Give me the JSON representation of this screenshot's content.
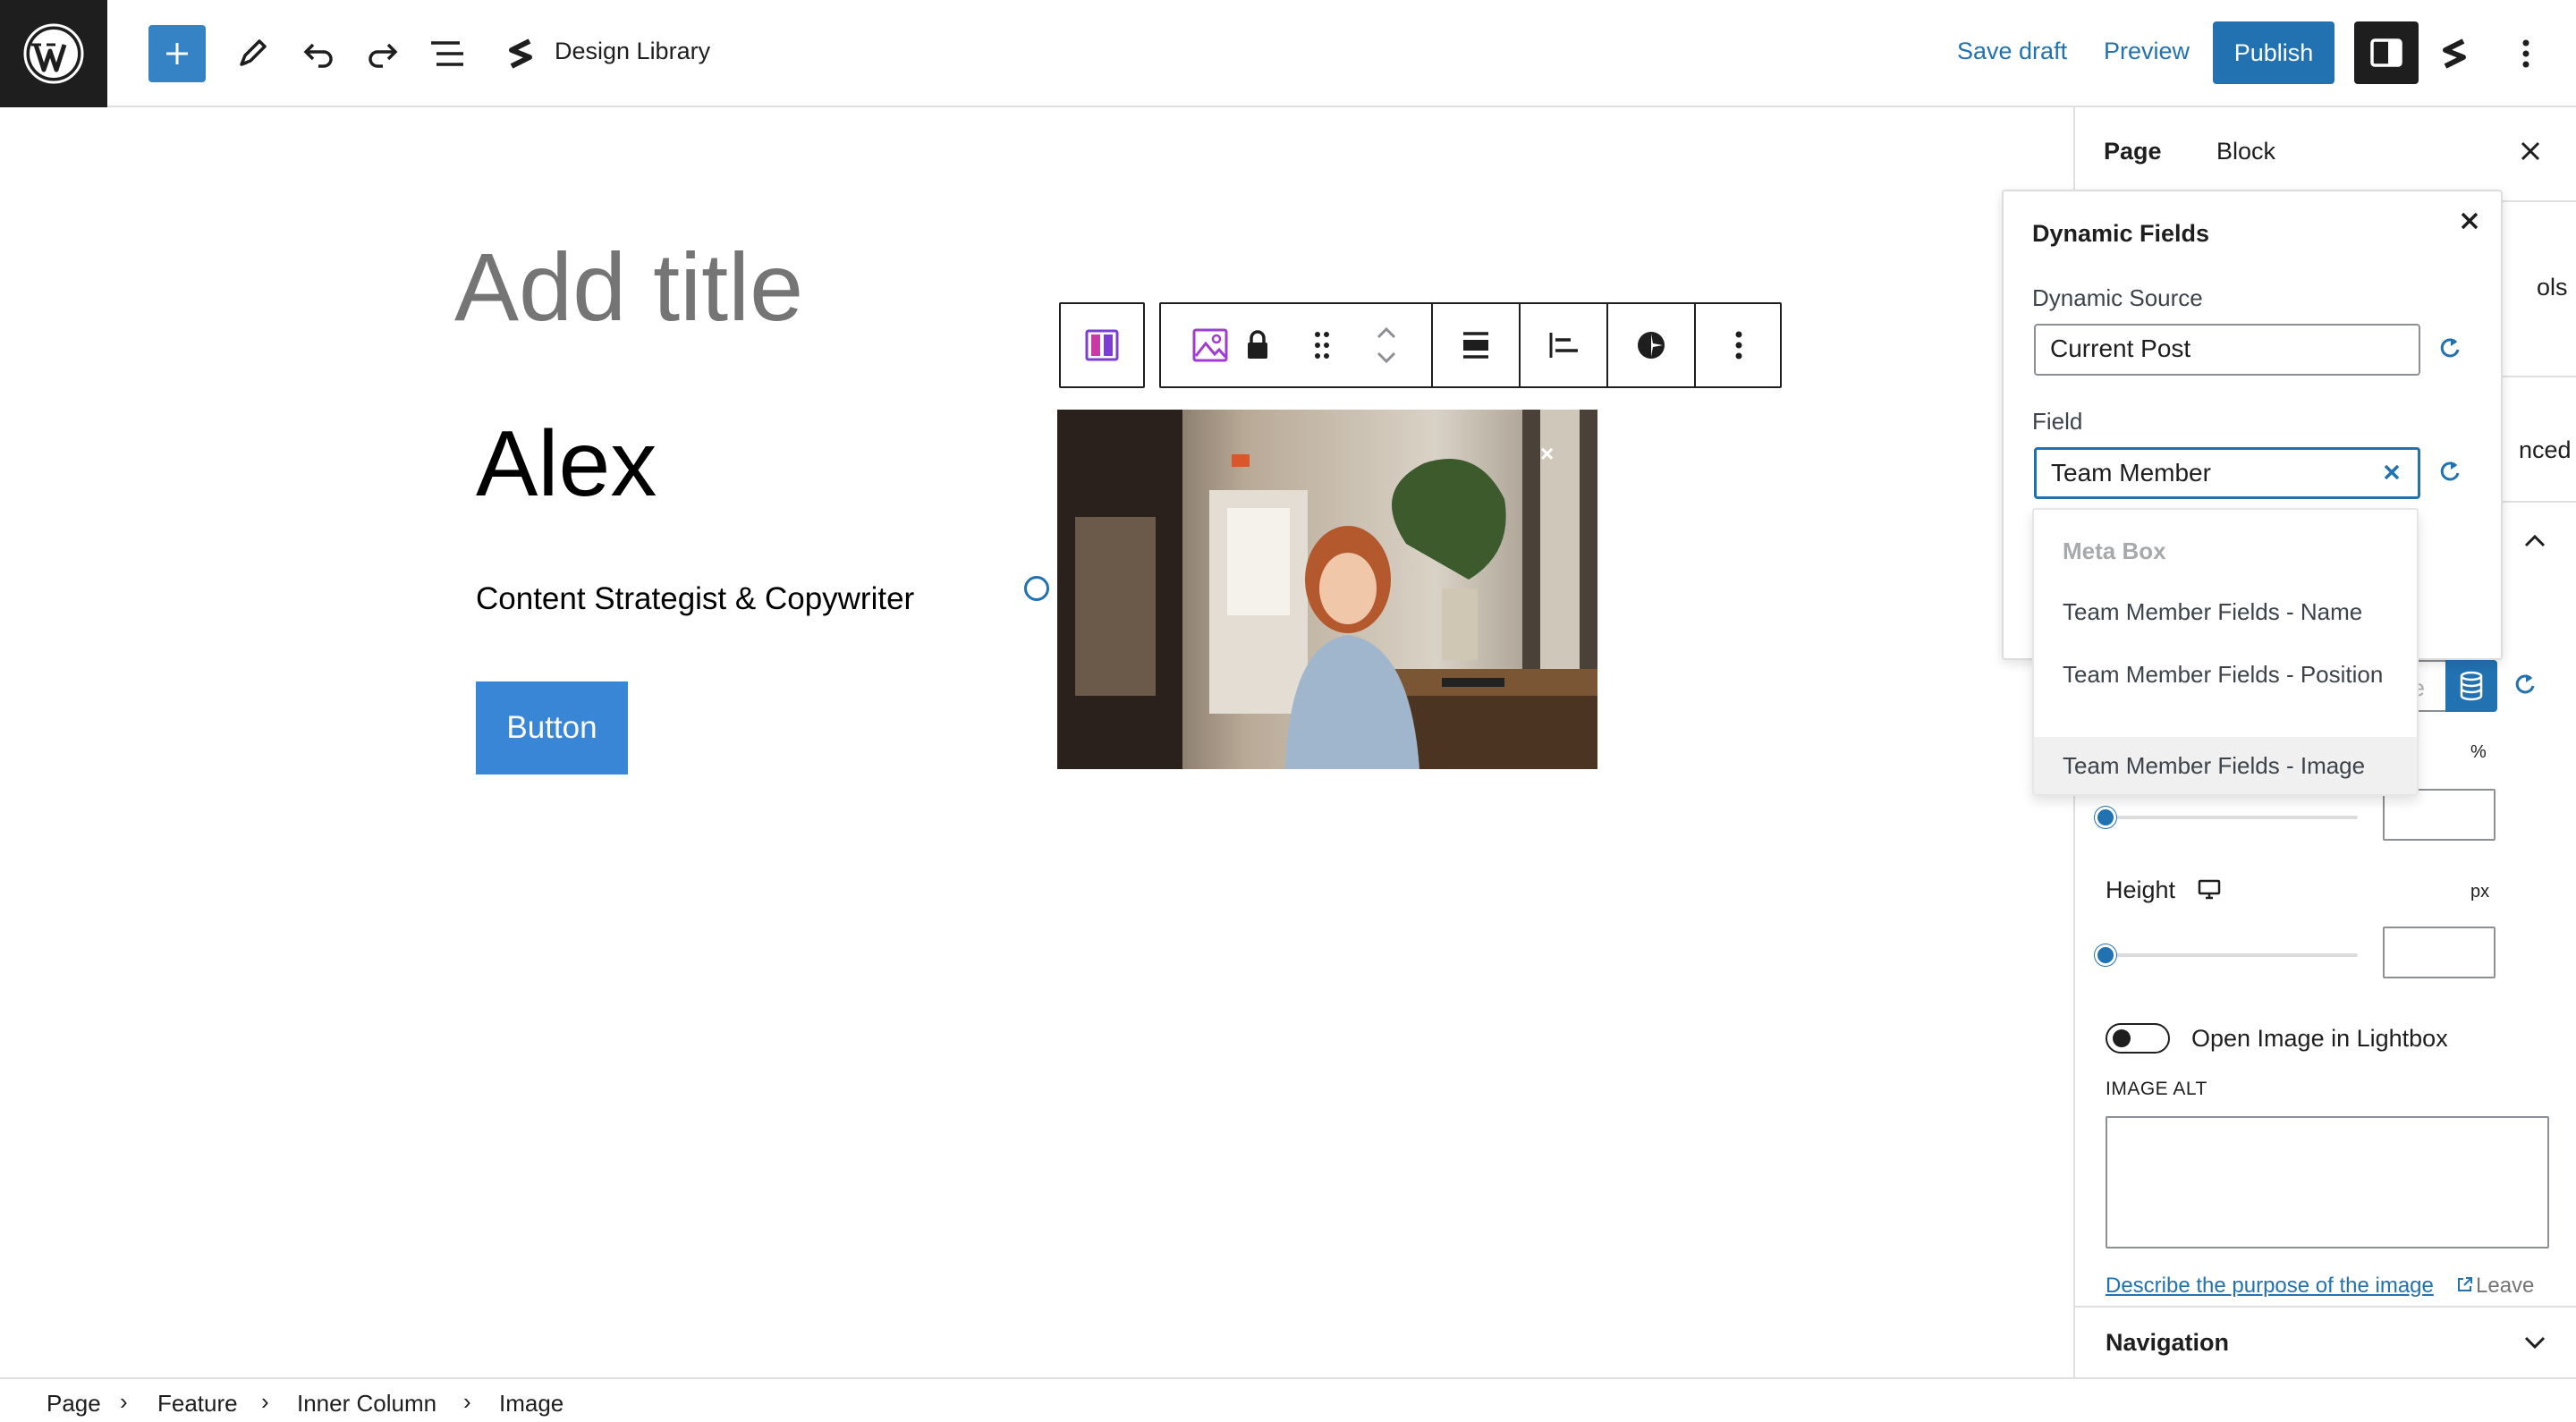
{
  "topbar": {
    "document_title": "Design Library",
    "save_draft": "Save draft",
    "preview": "Preview",
    "publish": "Publish"
  },
  "canvas": {
    "add_title_placeholder": "Add title",
    "name": "Alex",
    "role": "Content Strategist & Copywriter",
    "button_label": "Button"
  },
  "sidebar": {
    "tabs": [
      "Page",
      "Block"
    ],
    "partial_tools": "ols",
    "partial_advanced": "nced",
    "partial_input": "ge",
    "percent_unit": "%",
    "height_label": "Height",
    "px_unit": "px",
    "lightbox_label": "Open Image in Lightbox",
    "image_alt_label": "IMAGE ALT",
    "describe_link": "Describe the purpose of the image",
    "leave_text": "Leave",
    "navigation": "Navigation"
  },
  "popover": {
    "title": "Dynamic Fields",
    "source_label": "Dynamic Source",
    "source_value": "Current Post",
    "field_label": "Field",
    "field_value": "Team Member",
    "dropdown_group": "Meta Box",
    "options": [
      "Team Member Fields - Name",
      "Team Member Fields - Position",
      "Team Member Fields - Image"
    ]
  },
  "breadcrumb": [
    "Page",
    "Feature",
    "Inner Column",
    "Image"
  ],
  "colors": {
    "accent": "#2271b1",
    "dark": "#1e1e1e",
    "button_blue": "#3a86d6"
  }
}
